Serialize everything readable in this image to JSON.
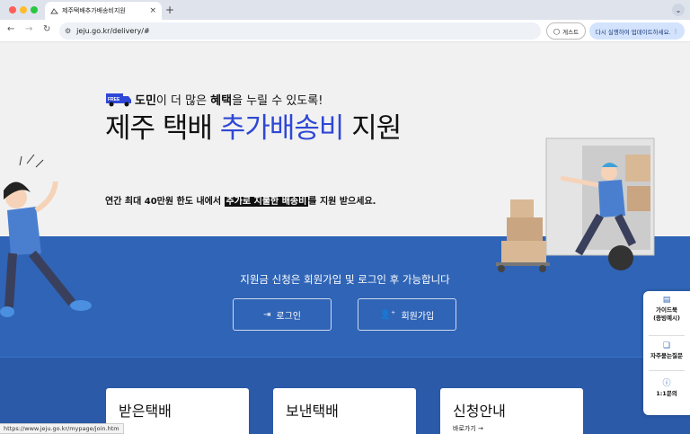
{
  "browser": {
    "tab_title": "제주택배추가배송비지원",
    "close_glyph": "×",
    "new_tab_glyph": "+",
    "tab_menu_glyph": "⌄",
    "url": "jeju.go.kr/delivery/#",
    "guest_label": "게스트",
    "update_label": "다시 실행하여 업데이트하세요.",
    "menu_glyph": "⋮",
    "status_url": "https://www.jeju.go.kr/mypage/join.htm"
  },
  "hero": {
    "free_badge": "FREE",
    "tagline_bold1": "도민",
    "tagline_mid1": "이 더 많은 ",
    "tagline_bold2": "혜택",
    "tagline_mid2": "을 누릴 수 있도록!",
    "title_part1": "제주 택배 ",
    "title_highlight": "추가배송비",
    "title_part2": " 지원",
    "annual_pre": "연간 최대 40만원 한도 내에서 ",
    "annual_mark": "추가로 지불한 배송비",
    "annual_post": "를 지원 받으세요."
  },
  "signup": {
    "notice": "지원금 신청은 회원가입 및 로그인 후 가능합니다",
    "login_label": "로그인",
    "join_label": "회원가입"
  },
  "cards": [
    {
      "title": "받은택배"
    },
    {
      "title": "보낸택배"
    },
    {
      "title": "신청안내",
      "link": "바로가기 →"
    }
  ],
  "floating_menu": {
    "guidebook_line1": "가이드북",
    "guidebook_line2": "(증빙예시)",
    "faq": "자주묻는질문",
    "inquiry": "1:1문의"
  },
  "colors": {
    "accent_blue": "#2f64b6",
    "title_highlight": "#2f47d6",
    "card_bar": "#f0d54a"
  }
}
